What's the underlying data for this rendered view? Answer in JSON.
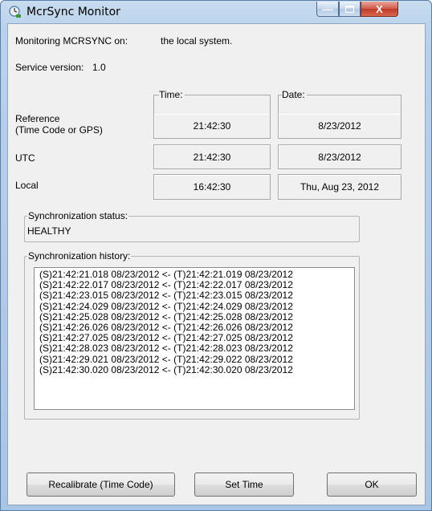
{
  "window": {
    "title": "McrSync Monitor",
    "minimize_glyph": "—",
    "maximize_glyph": "▫",
    "close_glyph": "X"
  },
  "info": {
    "monitoring_label": "Monitoring MCRSYNC on:",
    "monitoring_value": "the local system.",
    "service_label": "Service version:",
    "service_value": "1.0"
  },
  "time_table": {
    "time_header": "Time:",
    "date_header": "Date:",
    "rows": [
      {
        "label_line1": "Reference",
        "label_line2": "(Time Code or GPS)",
        "time": "21:42:30",
        "date": "8/23/2012"
      },
      {
        "label_line1": "UTC",
        "label_line2": "",
        "time": "21:42:30",
        "date": "8/23/2012"
      },
      {
        "label_line1": "Local",
        "label_line2": "",
        "time": "16:42:30",
        "date": "Thu, Aug 23, 2012"
      }
    ]
  },
  "sync_status": {
    "label": "Synchronization status:",
    "value": "HEALTHY"
  },
  "sync_history": {
    "label": "Synchronization history:",
    "entries": [
      "(S)21:42:21.018 08/23/2012 <- (T)21:42:21.019 08/23/2012",
      "(S)21:42:22.017 08/23/2012 <- (T)21:42:22.017 08/23/2012",
      "(S)21:42:23.015 08/23/2012 <- (T)21:42:23.015 08/23/2012",
      "(S)21:42:24.029 08/23/2012 <- (T)21:42:24.029 08/23/2012",
      "(S)21:42:25.028 08/23/2012 <- (T)21:42:25.028 08/23/2012",
      "(S)21:42:26.026 08/23/2012 <- (T)21:42:26.026 08/23/2012",
      "(S)21:42:27.025 08/23/2012 <- (T)21:42:27.025 08/23/2012",
      "(S)21:42:28.023 08/23/2012 <- (T)21:42:28.023 08/23/2012",
      "(S)21:42:29.021 08/23/2012 <- (T)21:42:29.022 08/23/2012",
      "(S)21:42:30.020 08/23/2012 <- (T)21:42:30.020 08/23/2012"
    ]
  },
  "buttons": {
    "recalibrate": "Recalibrate (Time Code)",
    "set_time": "Set Time",
    "ok": "OK"
  },
  "icons": {
    "app": "clock-sync-icon"
  },
  "colors": {
    "close_button": "#c8402e",
    "window_frame": "#b9d1ea"
  }
}
